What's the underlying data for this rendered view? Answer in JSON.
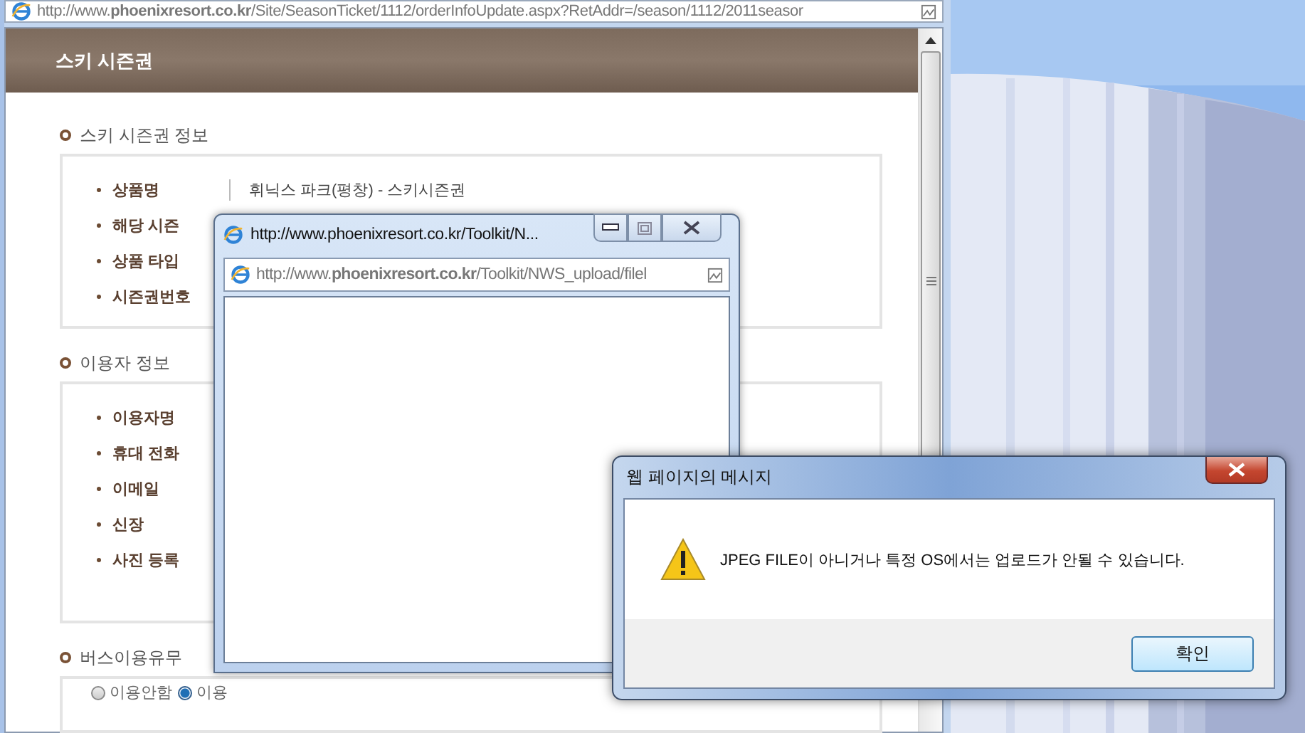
{
  "browser": {
    "address": "http://www.**phoenixresort.co.kr**/Site/SeasonTicket/1112/orderInfoUpdate.aspx?RetAddr=/season/1112/2011seasor",
    "page_title": "스키 시즌권",
    "sections": [
      {
        "heading": "스키 시즌권 정보",
        "kind": "fields",
        "rows": [
          {
            "label": "상품명",
            "value": "휘닉스 파크(평창) - 스키시즌권"
          },
          {
            "label": "해당 시즌"
          },
          {
            "label": "상품 타입"
          },
          {
            "label": "시즌권번호"
          }
        ]
      },
      {
        "heading": "이용자 정보",
        "kind": "fields",
        "rows": [
          {
            "label": "이용자명"
          },
          {
            "label": "휴대 전화"
          },
          {
            "label": "이메일"
          },
          {
            "label": "신장"
          },
          {
            "label": "사진 등록"
          }
        ]
      },
      {
        "heading": "버스이용유무",
        "kind": "radios",
        "options": [
          {
            "label": "이용안함",
            "selected": false
          },
          {
            "label": "이용",
            "selected": true
          }
        ]
      }
    ]
  },
  "popup": {
    "title": "http://www.phoenixresort.co.kr/Toolkit/N...",
    "address": "http://www.**phoenixresort.co.kr**/Toolkit/NWS_upload/filel"
  },
  "dialog": {
    "title": "웹 페이지의 메시지",
    "message": "JPEG FILE이 아니거나 특정 OS에서는 업로드가 안될 수 있습니다.",
    "button": "확인"
  }
}
